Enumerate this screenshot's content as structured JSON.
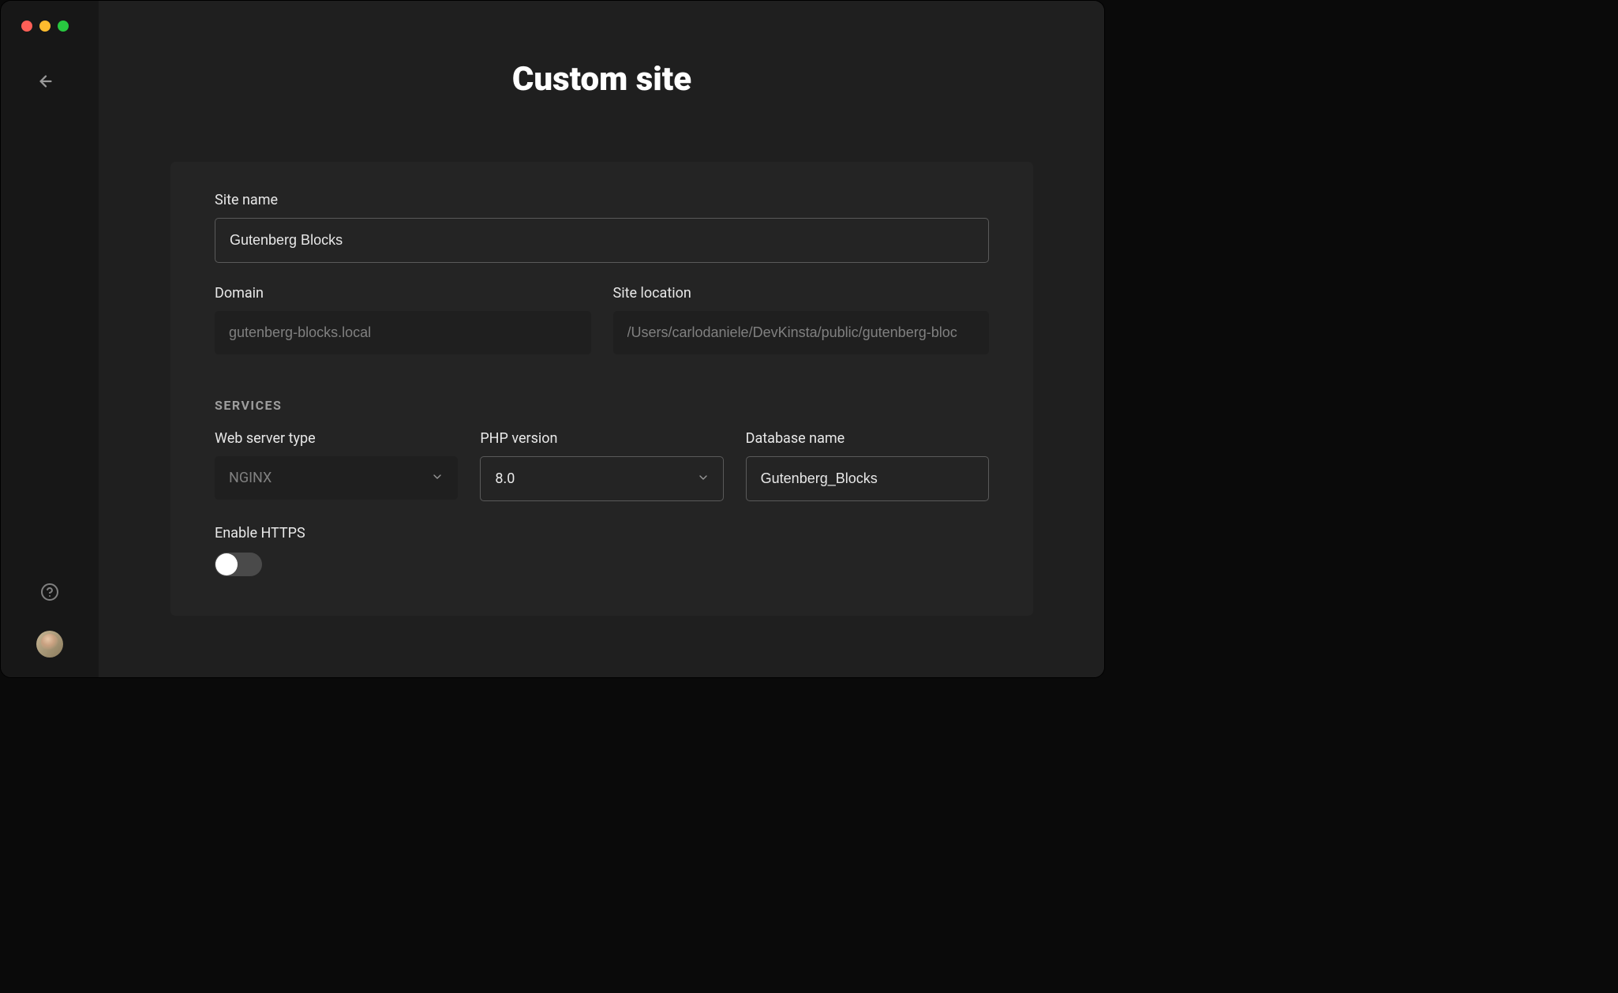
{
  "page_title": "Custom site",
  "form": {
    "site_name": {
      "label": "Site name",
      "value": "Gutenberg Blocks"
    },
    "domain": {
      "label": "Domain",
      "value": "gutenberg-blocks.local"
    },
    "site_location": {
      "label": "Site location",
      "value": "/Users/carlodaniele/DevKinsta/public/gutenberg-bloc"
    },
    "services_header": "SERVICES",
    "web_server": {
      "label": "Web server type",
      "value": "NGINX"
    },
    "php_version": {
      "label": "PHP version",
      "value": "8.0"
    },
    "database_name": {
      "label": "Database name",
      "value": "Gutenberg_Blocks"
    },
    "enable_https": {
      "label": "Enable HTTPS"
    }
  }
}
